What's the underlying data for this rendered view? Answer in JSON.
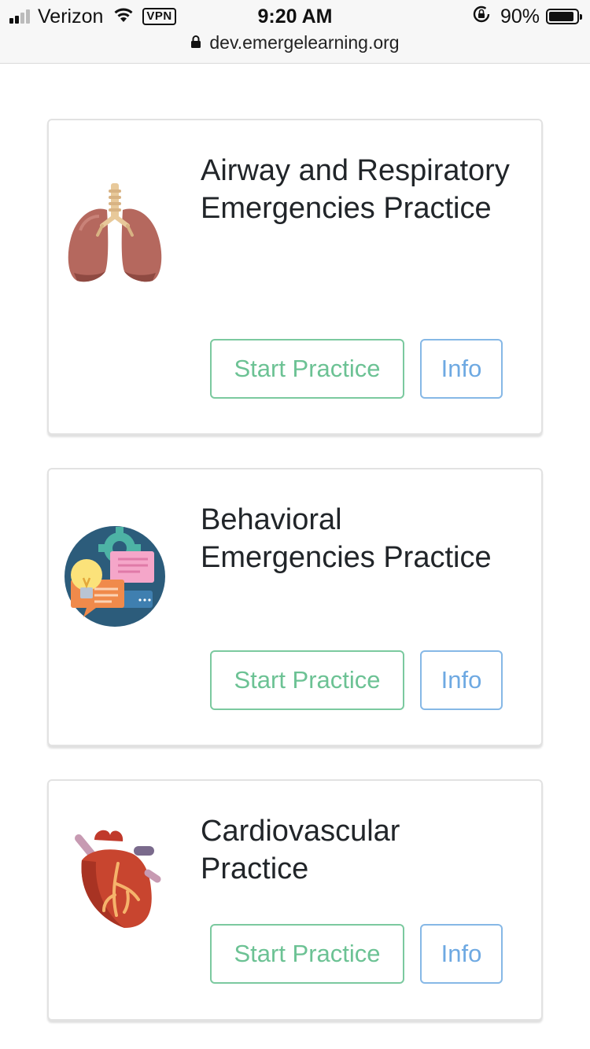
{
  "status_bar": {
    "carrier": "Verizon",
    "vpn_label": "VPN",
    "time": "9:20 AM",
    "battery_percent": "90%",
    "battery_level": 0.9,
    "icons": [
      "signal-icon",
      "wifi-icon",
      "rotation-lock-icon",
      "battery-icon"
    ]
  },
  "browser": {
    "url": "dev.emergelearning.org",
    "secure_icon": "padlock-icon"
  },
  "practices": [
    {
      "title": "Airway and Respiratory Emergencies Practice",
      "icon": "lungs-icon",
      "start_label": "Start Practice",
      "info_label": "Info"
    },
    {
      "title": "Behavioral Emergencies Practice",
      "icon": "lightbulb-gear-chat-icon",
      "start_label": "Start Practice",
      "info_label": "Info"
    },
    {
      "title": "Cardiovascular Practice",
      "icon": "heart-icon",
      "start_label": "Start Practice",
      "info_label": "Info"
    }
  ],
  "colors": {
    "start_button": "#6cc294",
    "info_button": "#6ea9e2",
    "card_border": "#e2e2e2"
  }
}
